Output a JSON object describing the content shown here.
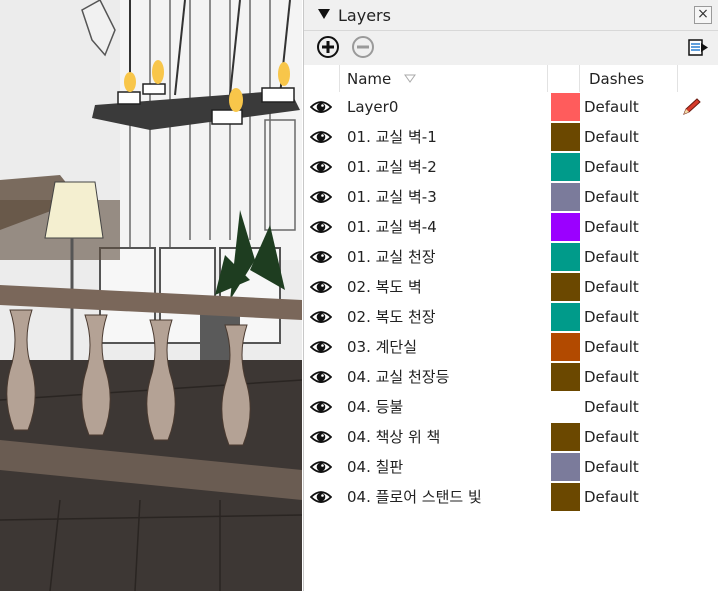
{
  "panel": {
    "title": "Layers",
    "close_glyph": "×",
    "toolbar": {
      "add_icon": "add-layer-icon",
      "remove_icon": "remove-layer-icon",
      "details_icon": "details-menu-icon"
    },
    "columns": {
      "name": "Name",
      "dashes": "Dashes"
    },
    "active_layer_icon": "pencil-icon",
    "layers": [
      {
        "name": "Layer0",
        "color": "#ff5c5c",
        "dashes": "Default"
      },
      {
        "name": "01. 교실 벽-1",
        "color": "#6b4800",
        "dashes": "Default"
      },
      {
        "name": "01. 교실 벽-2",
        "color": "#009b8a",
        "dashes": "Default"
      },
      {
        "name": "01. 교실 벽-3",
        "color": "#7b7b9b",
        "dashes": "Default"
      },
      {
        "name": "01. 교실 벽-4",
        "color": "#9b00ff",
        "dashes": "Default"
      },
      {
        "name": "01. 교실 천장",
        "color": "#009b8a",
        "dashes": "Default"
      },
      {
        "name": "02. 복도 벽",
        "color": "#6b4800",
        "dashes": "Default"
      },
      {
        "name": "02. 복도 천장",
        "color": "#009b8a",
        "dashes": "Default"
      },
      {
        "name": "03. 계단실",
        "color": "#b24a00",
        "dashes": "Default"
      },
      {
        "name": "04. 교실 천장등",
        "color": "#6b4800",
        "dashes": "Default"
      },
      {
        "name": "04. 등불",
        "color": "#ffffff",
        "dashes": "Default"
      },
      {
        "name": "04. 책상 위 책",
        "color": "#6b4800",
        "dashes": "Default"
      },
      {
        "name": "04. 칠판",
        "color": "#7b7b9b",
        "dashes": "Default"
      },
      {
        "name": "04. 플로어 스탠드 빛",
        "color": "#6b4800",
        "dashes": "Default"
      }
    ]
  }
}
